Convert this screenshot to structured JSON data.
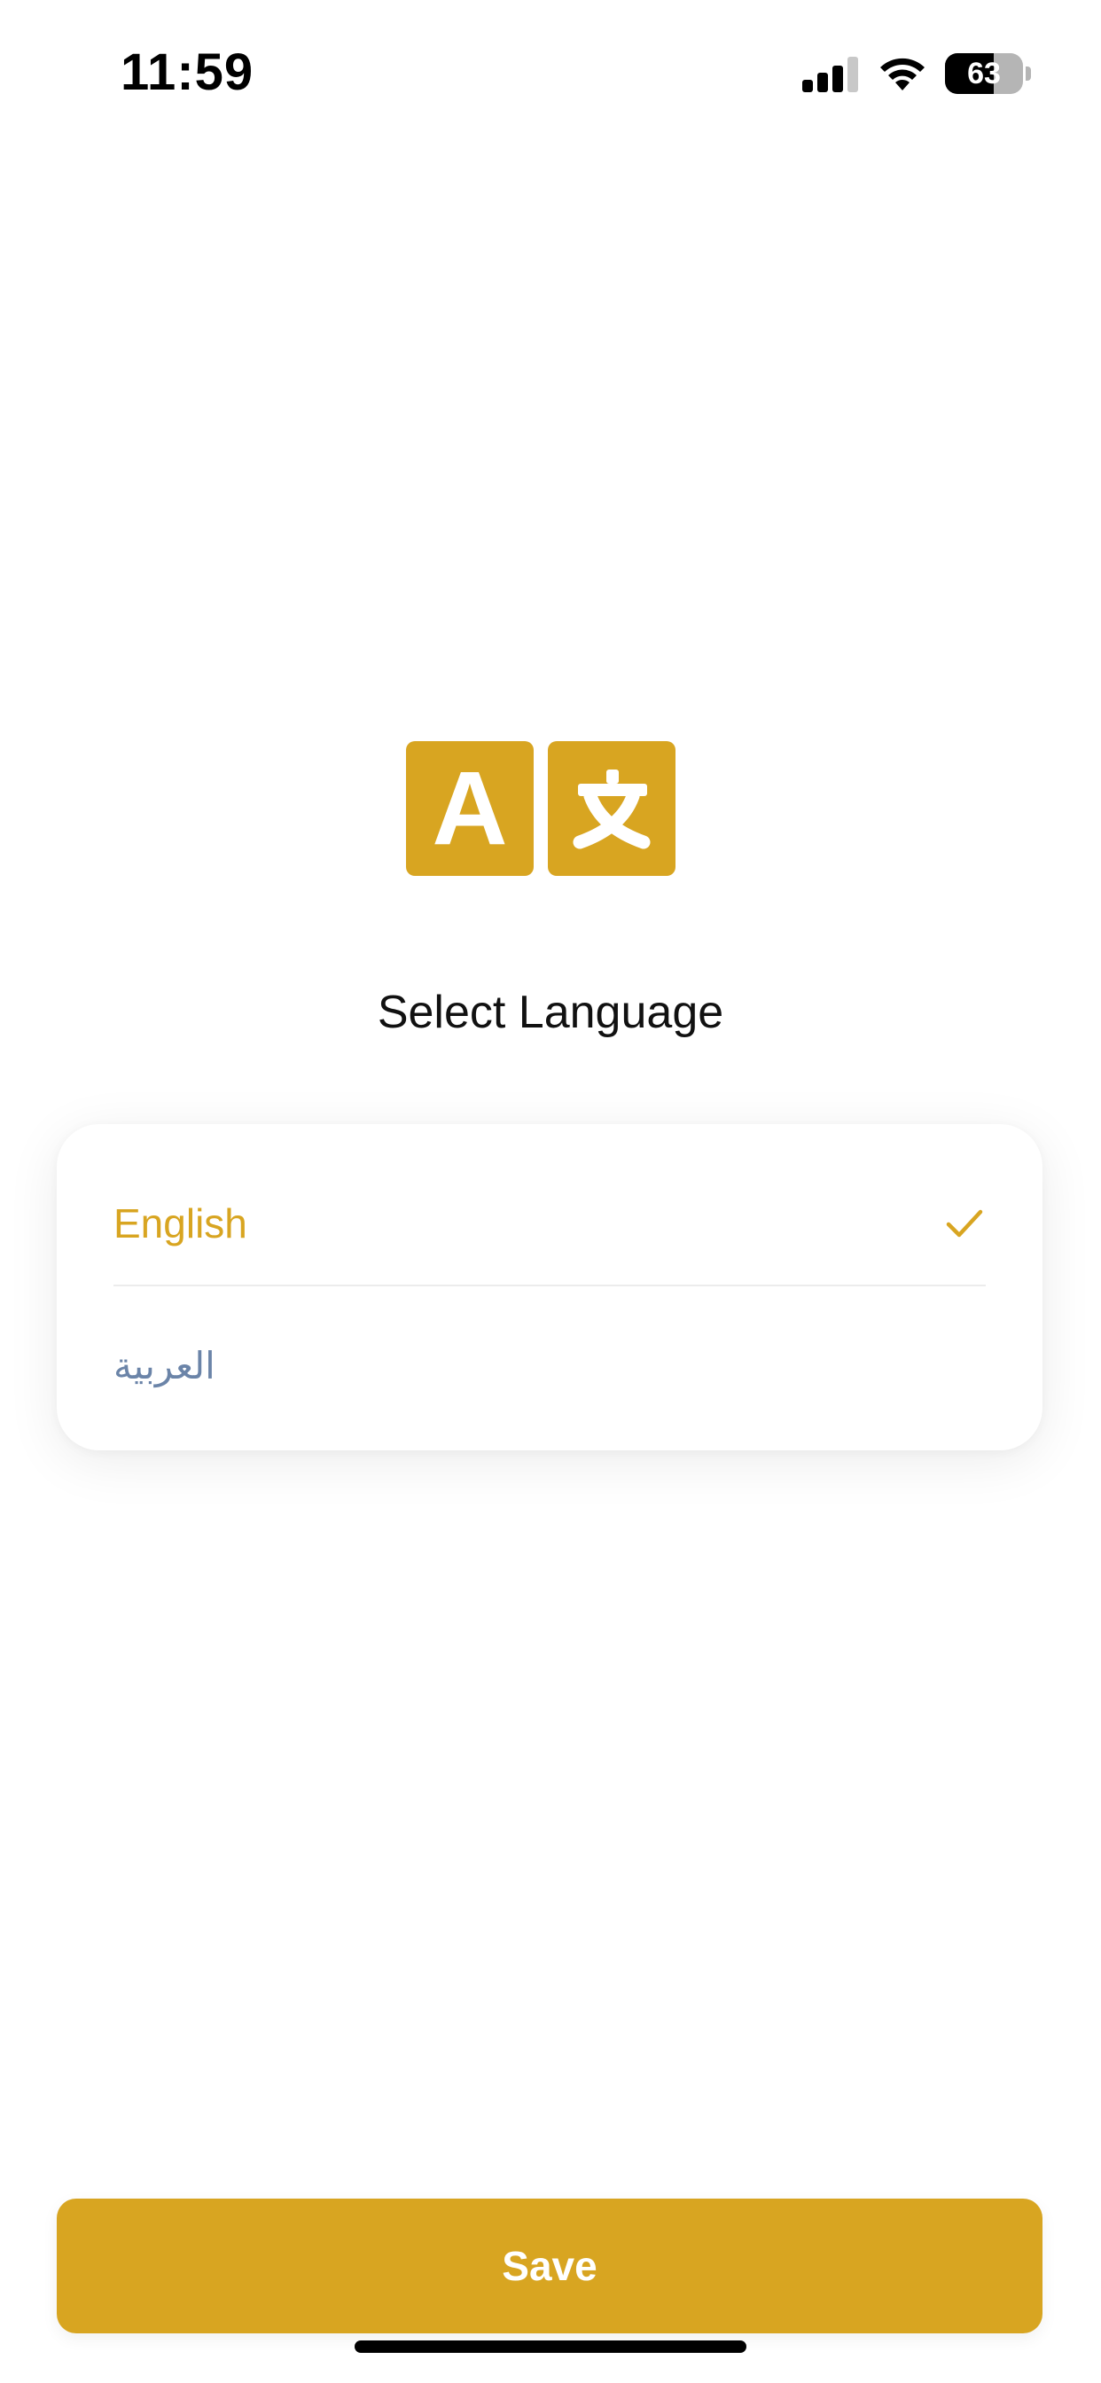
{
  "status_bar": {
    "time": "11:59",
    "battery_percent": "63",
    "battery_level": 0.63,
    "signal_bars_active": 3,
    "signal_bars_total": 4
  },
  "header": {
    "icon": "translate-icon",
    "title": "Select Language"
  },
  "languages": [
    {
      "label": "English",
      "selected": true
    },
    {
      "label": "العربية",
      "selected": false
    }
  ],
  "actions": {
    "save_label": "Save"
  },
  "colors": {
    "accent": "#d8a521",
    "unselected_text": "#6b84a8",
    "title_text": "#111111"
  }
}
